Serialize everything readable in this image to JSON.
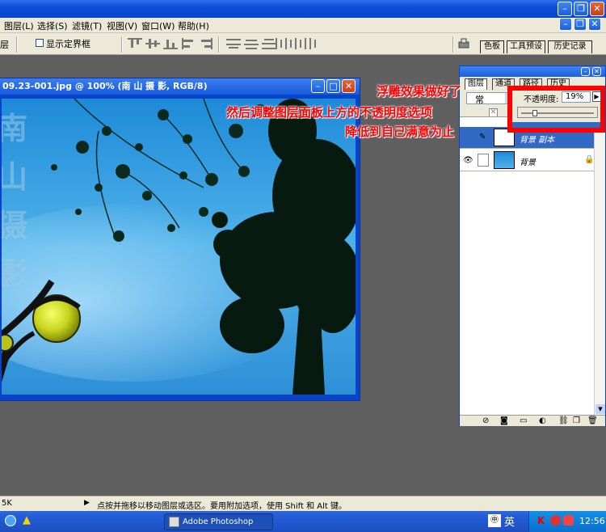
{
  "menubar": {
    "items": [
      "图层(L)",
      "选择(S)",
      "滤镜(T)",
      "视图(V)",
      "窗口(W)",
      "帮助(H)"
    ]
  },
  "options": {
    "partial_label": "层",
    "show_bounds_label": "显示定界框"
  },
  "palette_well": {
    "tabs": [
      "色板",
      "工具预设",
      "历史记录"
    ]
  },
  "document": {
    "title": "09.23-001.jpg @ 100% (南 山 摄 影, RGB/8)",
    "watermark": "南山摄影"
  },
  "layers_palette": {
    "tabs": [
      "图层",
      "通道",
      "路径",
      "历史"
    ],
    "blend_mode": "常",
    "opacity_label": "不透明度:",
    "opacity_value": "19%",
    "opacity_fraction": 0.19,
    "layers": [
      {
        "name": "背景 副本",
        "selected": true
      },
      {
        "name": "背景",
        "selected": false
      }
    ]
  },
  "annotations": {
    "line1": "浮雕效果做好了",
    "line2": "然后调整图层面板上方的不透明度选项",
    "line3": "降低到自己满意为止"
  },
  "statusbar": {
    "zoom_partial": "5K",
    "hint": "点按并拖移以移动图层或选区。要用附加选项，使用 Shift 和 Alt 键。"
  },
  "taskbar": {
    "app_label": "Adobe Photoshop",
    "ime": "英",
    "clock": "12:56"
  },
  "colors": {
    "annotation": "#ff0000",
    "title_blue": "#0a4fd8",
    "chrome": "#ece9d8"
  }
}
